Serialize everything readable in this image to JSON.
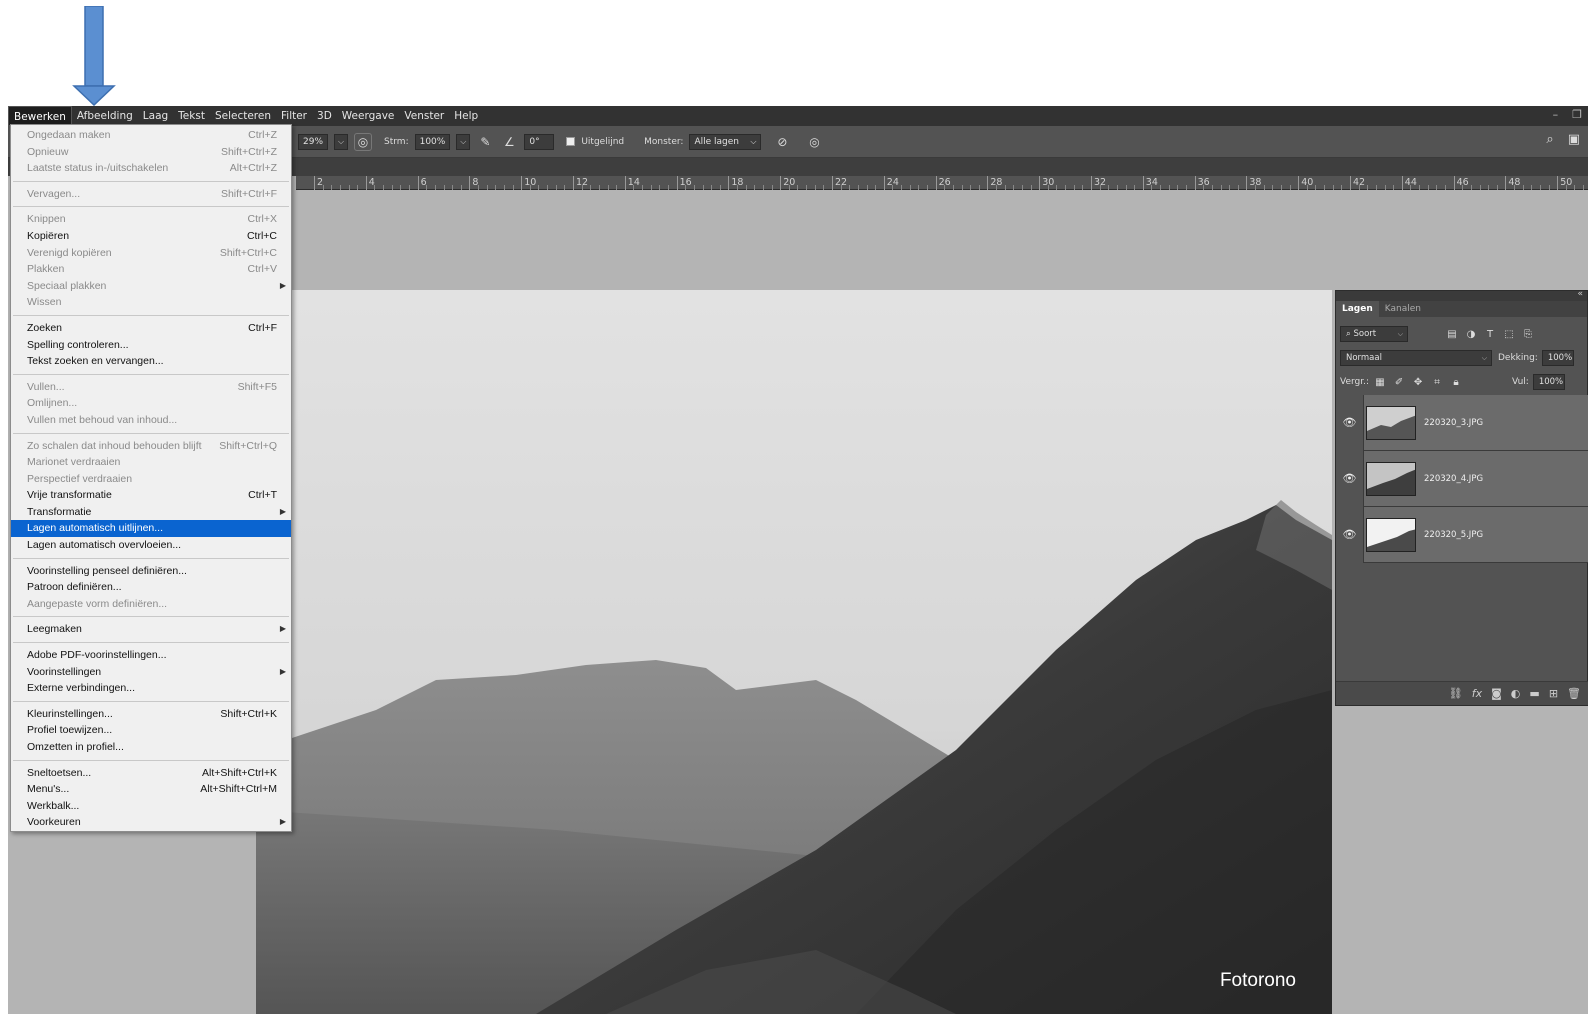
{
  "menubar": {
    "items": [
      "Bewerken",
      "Afbeelding",
      "Laag",
      "Tekst",
      "Selecteren",
      "Filter",
      "3D",
      "Weergave",
      "Venster",
      "Help"
    ]
  },
  "options": {
    "zoom": "29%",
    "strength_label": "Strm:",
    "strength_value": "100%",
    "angle_value": "0°",
    "aligned_label": "Uitgelijnd",
    "sample_label": "Monster:",
    "sample_value": "Alle lagen"
  },
  "ruler": [
    "2",
    "4",
    "6",
    "8",
    "10",
    "12",
    "14",
    "16",
    "18",
    "20",
    "22",
    "24",
    "26",
    "28",
    "30",
    "32",
    "34",
    "36",
    "38",
    "40",
    "42",
    "44",
    "46",
    "48",
    "50"
  ],
  "edit_menu": [
    {
      "label": "Ongedaan maken",
      "shortcut": "Ctrl+Z",
      "disabled": true
    },
    {
      "label": "Opnieuw",
      "shortcut": "Shift+Ctrl+Z",
      "disabled": true
    },
    {
      "label": "Laatste status in-/uitschakelen",
      "shortcut": "Alt+Ctrl+Z",
      "disabled": true
    },
    {
      "sep": true
    },
    {
      "label": "Vervagen...",
      "shortcut": "Shift+Ctrl+F",
      "disabled": true
    },
    {
      "sep": true
    },
    {
      "label": "Knippen",
      "shortcut": "Ctrl+X",
      "disabled": true
    },
    {
      "label": "Kopiëren",
      "shortcut": "Ctrl+C",
      "disabled": false
    },
    {
      "label": "Verenigd kopiëren",
      "shortcut": "Shift+Ctrl+C",
      "disabled": true
    },
    {
      "label": "Plakken",
      "shortcut": "Ctrl+V",
      "disabled": true
    },
    {
      "label": "Speciaal plakken",
      "shortcut": "",
      "disabled": true,
      "submenu": true
    },
    {
      "label": "Wissen",
      "shortcut": "",
      "disabled": true
    },
    {
      "sep": true
    },
    {
      "label": "Zoeken",
      "shortcut": "Ctrl+F",
      "disabled": false
    },
    {
      "label": "Spelling controleren...",
      "shortcut": "",
      "disabled": false
    },
    {
      "label": "Tekst zoeken en vervangen...",
      "shortcut": "",
      "disabled": false
    },
    {
      "sep": true
    },
    {
      "label": "Vullen...",
      "shortcut": "Shift+F5",
      "disabled": true
    },
    {
      "label": "Omlijnen...",
      "shortcut": "",
      "disabled": true
    },
    {
      "label": "Vullen met behoud van inhoud...",
      "shortcut": "",
      "disabled": true
    },
    {
      "sep": true
    },
    {
      "label": "Zo schalen dat inhoud behouden blijft",
      "shortcut": "Shift+Ctrl+Q",
      "disabled": true
    },
    {
      "label": "Marionet verdraaien",
      "shortcut": "",
      "disabled": true
    },
    {
      "label": "Perspectief verdraaien",
      "shortcut": "",
      "disabled": true
    },
    {
      "label": "Vrije transformatie",
      "shortcut": "Ctrl+T",
      "disabled": false
    },
    {
      "label": "Transformatie",
      "shortcut": "",
      "disabled": false,
      "submenu": true
    },
    {
      "label": "Lagen automatisch uitlijnen...",
      "shortcut": "",
      "disabled": false,
      "highlight": true
    },
    {
      "label": "Lagen automatisch overvloeien...",
      "shortcut": "",
      "disabled": false
    },
    {
      "sep": true
    },
    {
      "label": "Voorinstelling penseel definiëren...",
      "shortcut": "",
      "disabled": false
    },
    {
      "label": "Patroon definiëren...",
      "shortcut": "",
      "disabled": false
    },
    {
      "label": "Aangepaste vorm definiëren...",
      "shortcut": "",
      "disabled": true
    },
    {
      "sep": true
    },
    {
      "label": "Leegmaken",
      "shortcut": "",
      "disabled": false,
      "submenu": true
    },
    {
      "sep": true
    },
    {
      "label": "Adobe PDF-voorinstellingen...",
      "shortcut": "",
      "disabled": false
    },
    {
      "label": "Voorinstellingen",
      "shortcut": "",
      "disabled": false,
      "submenu": true
    },
    {
      "label": "Externe verbindingen...",
      "shortcut": "",
      "disabled": false
    },
    {
      "sep": true
    },
    {
      "label": "Kleurinstellingen...",
      "shortcut": "Shift+Ctrl+K",
      "disabled": false
    },
    {
      "label": "Profiel toewijzen...",
      "shortcut": "",
      "disabled": false
    },
    {
      "label": "Omzetten in profiel...",
      "shortcut": "",
      "disabled": false
    },
    {
      "sep": true
    },
    {
      "label": "Sneltoetsen...",
      "shortcut": "Alt+Shift+Ctrl+K",
      "disabled": false
    },
    {
      "label": "Menu's...",
      "shortcut": "Alt+Shift+Ctrl+M",
      "disabled": false
    },
    {
      "label": "Werkbalk...",
      "shortcut": "",
      "disabled": false
    },
    {
      "label": "Voorkeuren",
      "shortcut": "",
      "disabled": false,
      "submenu": true
    }
  ],
  "layers_panel": {
    "tabs": [
      "Lagen",
      "Kanalen"
    ],
    "filter_value": "Soort",
    "blend_mode": "Normaal",
    "opacity_label": "Dekking:",
    "opacity_value": "100%",
    "lock_label": "Vergr.:",
    "fill_label": "Vul:",
    "fill_value": "100%",
    "layers": [
      {
        "name": "220320_3.JPG"
      },
      {
        "name": "220320_4.JPG"
      },
      {
        "name": "220320_5.JPG"
      }
    ]
  },
  "watermark": "Fotorono",
  "colors": {
    "arrow": "#5b8fd1",
    "menu_highlight": "#0a64d0",
    "menubar_bg": "#323232",
    "panel_bg": "#535353"
  }
}
